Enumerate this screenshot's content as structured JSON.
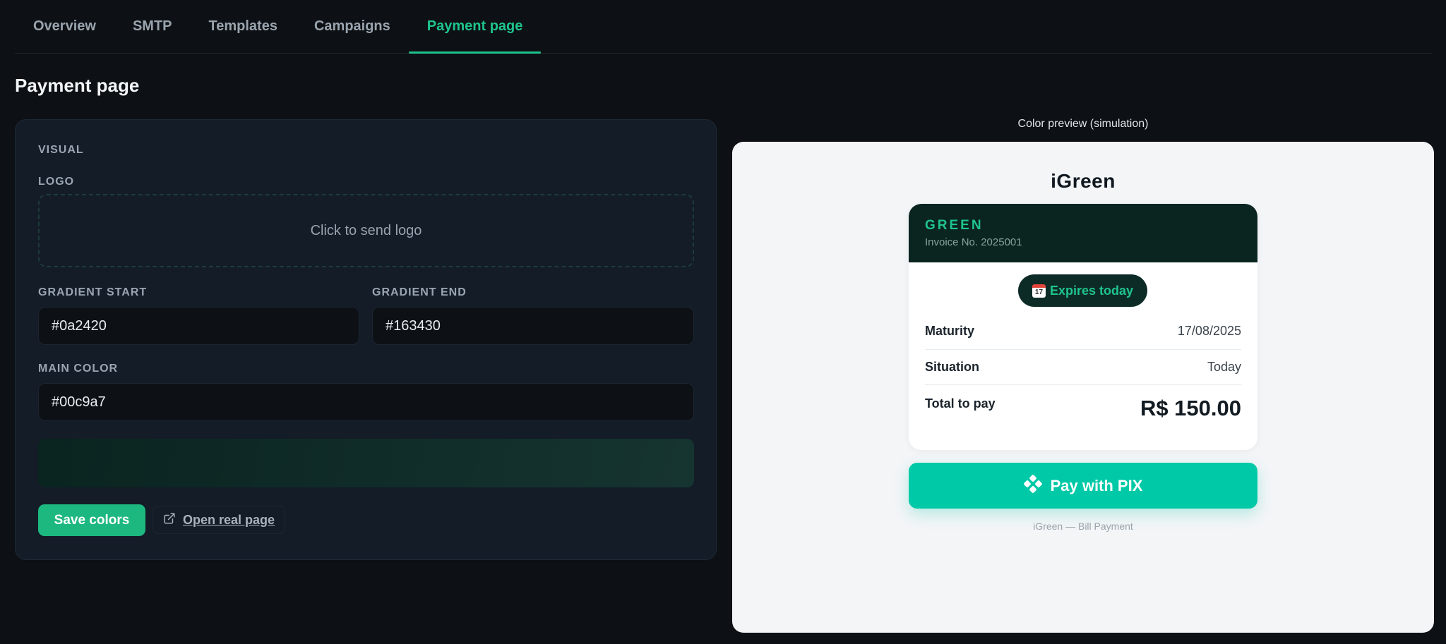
{
  "tabs": [
    {
      "label": "Overview"
    },
    {
      "label": "SMTP"
    },
    {
      "label": "Templates"
    },
    {
      "label": "Campaigns"
    },
    {
      "label": "Payment page",
      "active": true
    }
  ],
  "page_title": "Payment page",
  "visual": {
    "section_label": "VISUAL",
    "logo_label": "LOGO",
    "logo_placeholder": "Click to send logo",
    "gradient_start_label": "GRADIENT START",
    "gradient_start_value": "#0a2420",
    "gradient_end_label": "GRADIENT END",
    "gradient_end_value": "#163430",
    "main_color_label": "MAIN COLOR",
    "main_color_value": "#00c9a7",
    "save_label": "Save colors",
    "open_label": "Open real page",
    "open_icon": "external-link-icon"
  },
  "preview": {
    "caption": "Color preview (simulation)",
    "brand": "iGreen",
    "card_brand": "GREEN",
    "invoice": "Invoice No. 2025001",
    "expires": "Expires today",
    "expires_icon": "calendar-icon",
    "maturity_label": "Maturity",
    "maturity_value": "17/08/2025",
    "situation_label": "Situation",
    "situation_value": "Today",
    "total_label": "Total to pay",
    "total_value": "R$ 150.00",
    "pay_label": "Pay with PIX",
    "pay_icon": "pix-icon",
    "footer": "iGreen — Bill Payment"
  },
  "colors": {
    "accent": "#1fc48c",
    "main": "#00c9a7",
    "gradient_start": "#0a2420",
    "gradient_end": "#163430"
  }
}
